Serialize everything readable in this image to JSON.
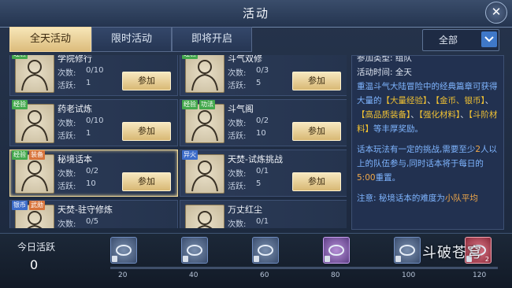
{
  "window": {
    "title": "活动",
    "close_glyph": "✕"
  },
  "tabs": [
    {
      "label": "全天活动",
      "active": true
    },
    {
      "label": "限时活动",
      "active": false
    },
    {
      "label": "即将开启",
      "active": false
    }
  ],
  "filter": {
    "selected": "全部"
  },
  "activities": [
    {
      "name": "学院修行",
      "tags": [
        {
          "text": "经验",
          "color": "green"
        }
      ],
      "count_label": "次数:",
      "count": "0/10",
      "active_label": "活跃:",
      "active": "1",
      "button": "参加"
    },
    {
      "name": "斗气双修",
      "tags": [
        {
          "text": "经验",
          "color": "green"
        }
      ],
      "count_label": "次数:",
      "count": "0/3",
      "active_label": "活跃:",
      "active": "5",
      "button": "参加"
    },
    {
      "name": "药老试炼",
      "tags": [
        {
          "text": "经验",
          "color": "green"
        }
      ],
      "count_label": "次数:",
      "count": "0/10",
      "active_label": "活跃:",
      "active": "1",
      "button": "参加"
    },
    {
      "name": "斗气阁",
      "tags": [
        {
          "text": "经验",
          "color": "green"
        },
        {
          "text": "功法",
          "color": "green"
        }
      ],
      "count_label": "次数:",
      "count": "0/2",
      "active_label": "活跃:",
      "active": "10",
      "button": "参加"
    },
    {
      "name": "秘境话本",
      "tags": [
        {
          "text": "经验",
          "color": "green"
        },
        {
          "text": "装备",
          "color": "orange"
        }
      ],
      "count_label": "次数:",
      "count": "0/2",
      "active_label": "活跃:",
      "active": "10",
      "button": "参加",
      "selected": true
    },
    {
      "name": "天焚-试炼挑战",
      "tags": [
        {
          "text": "异火",
          "color": "blue"
        }
      ],
      "count_label": "次数:",
      "count": "0/1",
      "active_label": "活跃:",
      "active": "5",
      "button": "参加"
    },
    {
      "name": "天焚-驻守修炼",
      "tags": [
        {
          "text": "银币",
          "color": "blue"
        },
        {
          "text": "武勋",
          "color": "orange"
        }
      ],
      "count_label": "次数:",
      "count": "0/5",
      "active_label": "",
      "active": "",
      "button": ""
    },
    {
      "name": "万丈红尘",
      "tags": [],
      "count_label": "次数:",
      "count": "0/1",
      "active_label": "",
      "active": "",
      "button": ""
    }
  ],
  "detail": {
    "type_line": "参加类型: 组队",
    "time_line": "活动时间: 全天",
    "desc_1": "重温斗气大陆冒险中的经典篇章可获得大量的",
    "reward_1": "【大量经验】",
    "sep_1": "、",
    "reward_2": "【金币、银币】",
    "sep_2": "、",
    "reward_3": "【高品质装备】",
    "sep_3": "、",
    "reward_4": "【强化材料】",
    "sep_4": "、",
    "reward_5": "【斗阶材料】",
    "desc_2": "等丰厚奖励。",
    "rule_1": "话本玩法有一定的挑战,需要至少",
    "rule_num": "2",
    "rule_2": "人以上的队伍参与,同时话本将于每日的",
    "rule_time": "5:00",
    "rule_3": "重置。",
    "note_1": "注意: 秘境话本的难度为",
    "note_hl": "小队平均"
  },
  "activity_bar": {
    "label": "今日活跃",
    "value": "0",
    "milestones": [
      {
        "mark": "20",
        "color": "grey",
        "count": ""
      },
      {
        "mark": "40",
        "color": "grey",
        "count": ""
      },
      {
        "mark": "60",
        "color": "grey",
        "count": ""
      },
      {
        "mark": "80",
        "color": "purple",
        "count": ""
      },
      {
        "mark": "100",
        "color": "grey",
        "count": ""
      },
      {
        "mark": "120",
        "color": "red",
        "count": "2"
      }
    ],
    "progress": 0
  },
  "logo_text": "斗破苍穹"
}
